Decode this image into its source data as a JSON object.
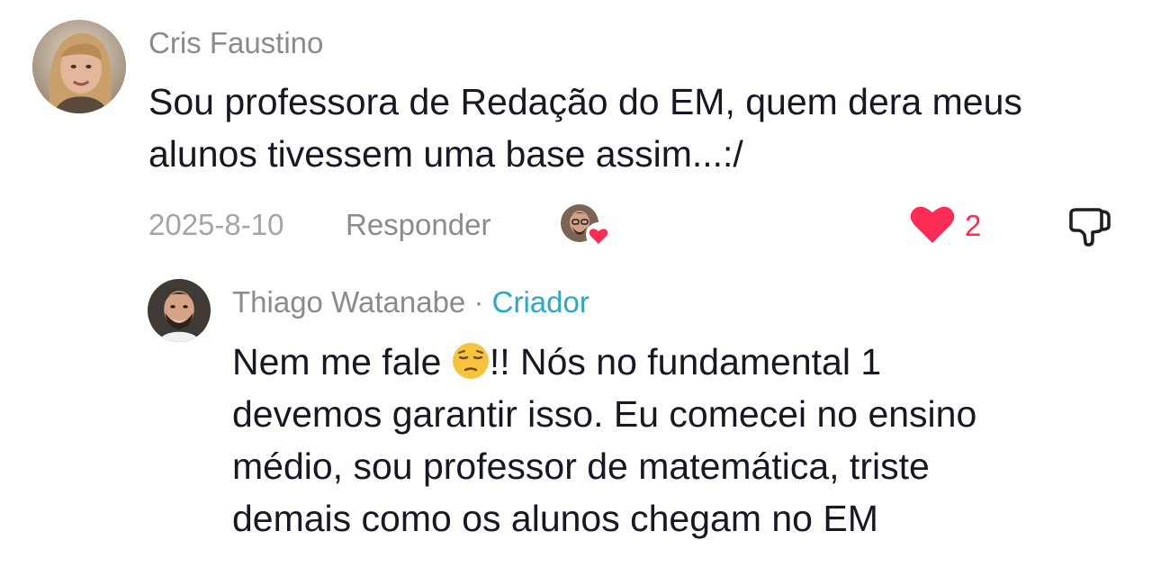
{
  "comment": {
    "author": "Cris Faustino",
    "lines": [
      "Sou professora de Redação do EM, quem dera meus",
      "alunos tivessem uma base assim...:/"
    ],
    "date": "2025-8-10",
    "reply_label": "Responder",
    "like_count": "2",
    "icons": {
      "liked_by_creator": "creator-liked-heart-icon",
      "like": "heart-icon",
      "dislike": "thumbs-down-icon"
    },
    "colors": {
      "like": "#fe2c55",
      "text": "#161823",
      "meta": "#8a8b91"
    }
  },
  "reply": {
    "author": "Thiago Watanabe",
    "separator": "·",
    "author_badge": "Criador",
    "line1_before_emoji": "Nem me fale ",
    "line1_after_emoji": "!! Nós no fundamental 1",
    "lines": [
      "devemos garantir isso. Eu comecei no ensino",
      "médio, sou professor de matemática, triste",
      "demais como os alunos chegam no EM"
    ],
    "emoji": "pensive-face-emoji",
    "colors": {
      "creator_badge": "#2aa8c4"
    }
  }
}
